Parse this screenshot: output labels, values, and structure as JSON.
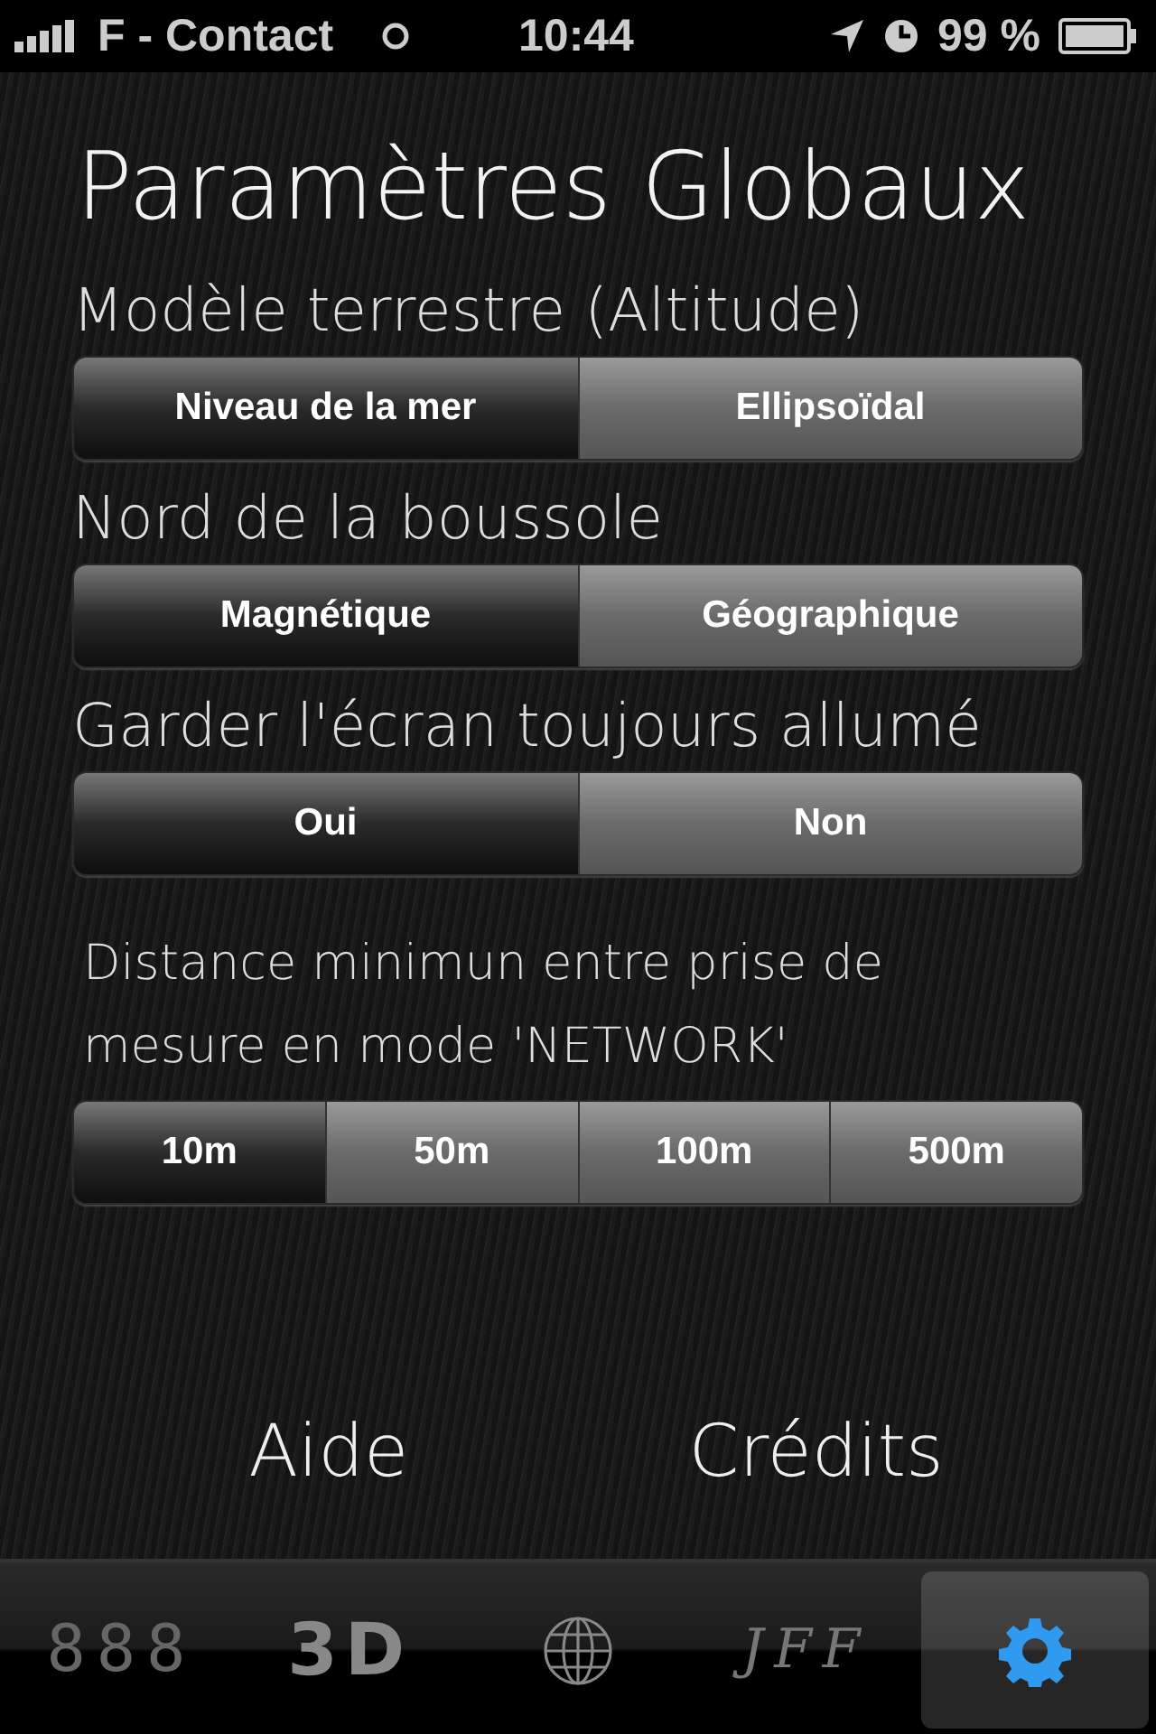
{
  "status_bar": {
    "carrier": "F - Contact",
    "time": "10:44",
    "battery": "99 %"
  },
  "title": "Paramètres Globaux",
  "settings": [
    {
      "kind": "large",
      "label": "Modèle terrestre (Altitude)",
      "options": [
        {
          "label": "Niveau de la mer",
          "selected": true
        },
        {
          "label": "Ellipsoïdal",
          "selected": false
        }
      ]
    },
    {
      "kind": "large",
      "label": "Nord de la boussole",
      "options": [
        {
          "label": "Magnétique",
          "selected": true
        },
        {
          "label": "Géographique",
          "selected": false
        }
      ]
    },
    {
      "kind": "large",
      "label": "Garder l'écran toujours allumé",
      "options": [
        {
          "label": "Oui",
          "selected": true
        },
        {
          "label": "Non",
          "selected": false
        }
      ]
    },
    {
      "label": "Distance minimun entre prise de mesure en mode 'NETWORK'",
      "kind": "small",
      "options": [
        {
          "label": "10m",
          "selected": true
        },
        {
          "label": "50m",
          "selected": false
        },
        {
          "label": "100m",
          "selected": false
        },
        {
          "label": "500m",
          "selected": false
        }
      ]
    }
  ],
  "links": [
    "Aide",
    "Crédits"
  ],
  "tab_bar": [
    {
      "kind": "digits",
      "label": "888",
      "selected": false
    },
    {
      "kind": "bold3d",
      "label": "3D",
      "selected": false
    },
    {
      "kind": "globe",
      "selected": false
    },
    {
      "kind": "script",
      "label": "JFF",
      "selected": false
    },
    {
      "kind": "gear",
      "selected": true
    }
  ]
}
